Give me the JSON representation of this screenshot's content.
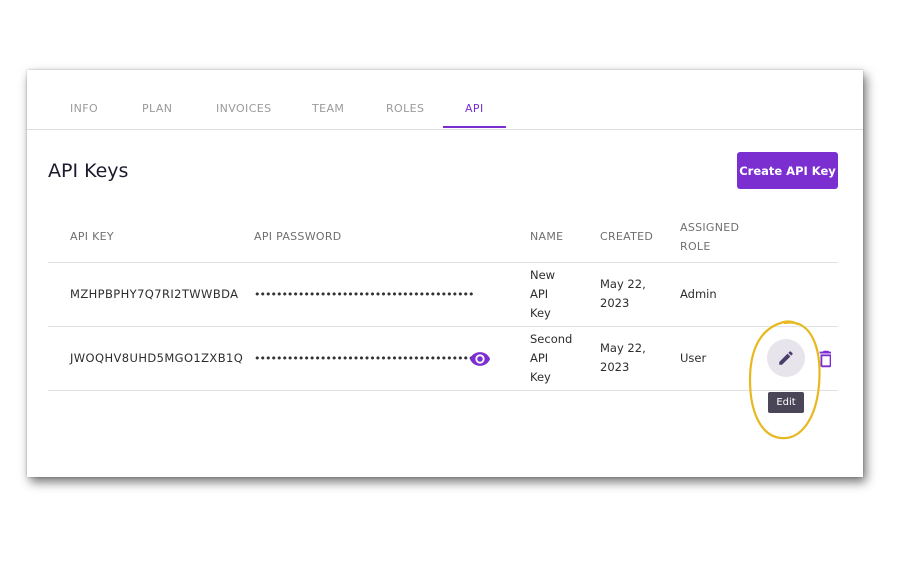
{
  "tabs": [
    {
      "label": "INFO"
    },
    {
      "label": "PLAN"
    },
    {
      "label": "INVOICES"
    },
    {
      "label": "TEAM"
    },
    {
      "label": "ROLES"
    },
    {
      "label": "API",
      "active": true
    }
  ],
  "page": {
    "title": "API Keys",
    "create_button_label": "Create API Key"
  },
  "table": {
    "headers": {
      "api_key": "API KEY",
      "api_password": "API PASSWORD",
      "name": "NAME",
      "created": "CREATED",
      "assigned_role_line1": "ASSIGNED",
      "assigned_role_line2": "ROLE"
    },
    "rows": [
      {
        "api_key": "MZHPBPHY7Q7RI2TWWBDA",
        "password_mask": "••••••••••••••••••••••••••••••••••••••••",
        "name_lines": [
          "New",
          "API",
          "Key"
        ],
        "created_lines": [
          "May 22,",
          "2023"
        ],
        "role": "Admin"
      },
      {
        "api_key": "JWOQHV8UHD5MGO1ZXB1Q",
        "password_mask": "••••••••••••••••••••••••••••••••••••••••",
        "name_lines": [
          "Second",
          "API",
          "Key"
        ],
        "created_lines": [
          "May 22,",
          "2023"
        ],
        "role": "User"
      }
    ]
  },
  "tooltip": {
    "label": "Edit"
  },
  "icons": {
    "reveal": "eye-icon",
    "edit": "pencil-icon",
    "delete": "trash-icon"
  },
  "colors": {
    "accent": "#7b2fd0",
    "highlight": "#e8b820",
    "tooltip_bg": "#4b4558"
  }
}
